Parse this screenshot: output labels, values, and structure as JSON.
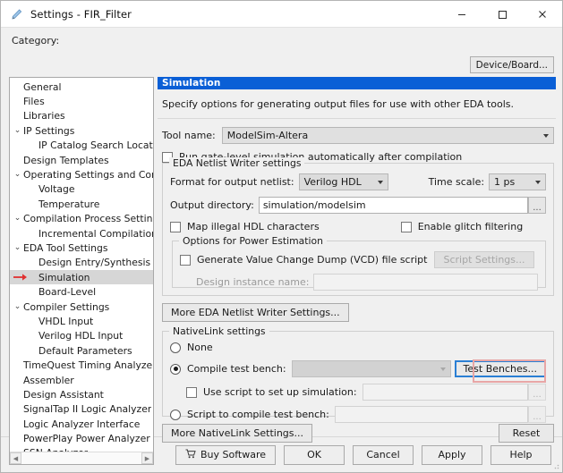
{
  "window": {
    "title": "Settings - FIR_Filter",
    "icon": "pencil-icon",
    "minimize": "minimize-icon",
    "maximize": "maximize-icon",
    "close": "close-icon"
  },
  "category": {
    "label": "Category:",
    "device_board_button": "Device/Board...",
    "selected": "Simulation",
    "items": [
      {
        "label": "General",
        "indent": 0,
        "twisty": ""
      },
      {
        "label": "Files",
        "indent": 0,
        "twisty": ""
      },
      {
        "label": "Libraries",
        "indent": 0,
        "twisty": ""
      },
      {
        "label": "IP Settings",
        "indent": 0,
        "twisty": "v"
      },
      {
        "label": "IP Catalog Search Locations",
        "indent": 1,
        "twisty": ""
      },
      {
        "label": "Design Templates",
        "indent": 0,
        "twisty": ""
      },
      {
        "label": "Operating Settings and Conditions",
        "indent": 0,
        "twisty": "v"
      },
      {
        "label": "Voltage",
        "indent": 1,
        "twisty": ""
      },
      {
        "label": "Temperature",
        "indent": 1,
        "twisty": ""
      },
      {
        "label": "Compilation Process Settings",
        "indent": 0,
        "twisty": "v"
      },
      {
        "label": "Incremental Compilation",
        "indent": 1,
        "twisty": ""
      },
      {
        "label": "EDA Tool Settings",
        "indent": 0,
        "twisty": "v"
      },
      {
        "label": "Design Entry/Synthesis",
        "indent": 1,
        "twisty": ""
      },
      {
        "label": "Simulation",
        "indent": 1,
        "twisty": ""
      },
      {
        "label": "Board-Level",
        "indent": 1,
        "twisty": ""
      },
      {
        "label": "Compiler Settings",
        "indent": 0,
        "twisty": "v"
      },
      {
        "label": "VHDL Input",
        "indent": 1,
        "twisty": ""
      },
      {
        "label": "Verilog HDL Input",
        "indent": 1,
        "twisty": ""
      },
      {
        "label": "Default Parameters",
        "indent": 1,
        "twisty": ""
      },
      {
        "label": "TimeQuest Timing Analyzer",
        "indent": 0,
        "twisty": ""
      },
      {
        "label": "Assembler",
        "indent": 0,
        "twisty": ""
      },
      {
        "label": "Design Assistant",
        "indent": 0,
        "twisty": ""
      },
      {
        "label": "SignalTap II Logic Analyzer",
        "indent": 0,
        "twisty": ""
      },
      {
        "label": "Logic Analyzer Interface",
        "indent": 0,
        "twisty": ""
      },
      {
        "label": "PowerPlay Power Analyzer Settings",
        "indent": 0,
        "twisty": ""
      },
      {
        "label": "SSN Analyzer",
        "indent": 0,
        "twisty": ""
      }
    ]
  },
  "panel": {
    "header": "Simulation",
    "description": "Specify options for generating output files for use with other EDA tools.",
    "tool_name_label": "Tool name:",
    "tool_name_value": "ModelSim-Altera",
    "run_gate_level_label": "Run gate-level simulation automatically after compilation",
    "run_gate_level_checked": false
  },
  "netlist": {
    "group_title": "EDA Netlist Writer settings",
    "format_label": "Format for output netlist:",
    "format_value": "Verilog HDL",
    "timescale_label": "Time scale:",
    "timescale_value": "1 ps",
    "output_dir_label": "Output directory:",
    "output_dir_value": "simulation/modelsim",
    "browse_label": "...",
    "map_illegal_label": "Map illegal HDL characters",
    "map_illegal_checked": false,
    "glitch_label": "Enable glitch filtering",
    "glitch_checked": false,
    "power_group_title": "Options for Power Estimation",
    "vcd_label": "Generate Value Change Dump (VCD) file script",
    "vcd_checked": false,
    "script_settings_button": "Script Settings...",
    "design_instance_label": "Design instance name:",
    "design_instance_value": "",
    "more_settings_button": "More EDA Netlist Writer Settings..."
  },
  "nativelink": {
    "group_title": "NativeLink settings",
    "none_label": "None",
    "none_selected": false,
    "compile_tb_label": "Compile test bench:",
    "compile_tb_selected": true,
    "compile_tb_value": "",
    "test_benches_button": "Test Benches...",
    "use_script_label": "Use script to set up simulation:",
    "use_script_checked": false,
    "use_script_value": "",
    "script_compile_label": "Script to compile test bench:",
    "script_compile_selected": false,
    "script_compile_value": "",
    "browse_label": "...",
    "more_settings_button": "More NativeLink Settings...",
    "reset_button": "Reset"
  },
  "footer": {
    "buy_label": "Buy Software",
    "buy_icon": "cart-icon",
    "ok_label": "OK",
    "cancel_label": "Cancel",
    "apply_label": "Apply",
    "help_label": "Help"
  },
  "colors": {
    "header_blue": "#0a5fd6",
    "focus_blue": "#2a7fd4",
    "highlight_pink": "#e8a6a6",
    "arrow_red": "#e03030"
  }
}
